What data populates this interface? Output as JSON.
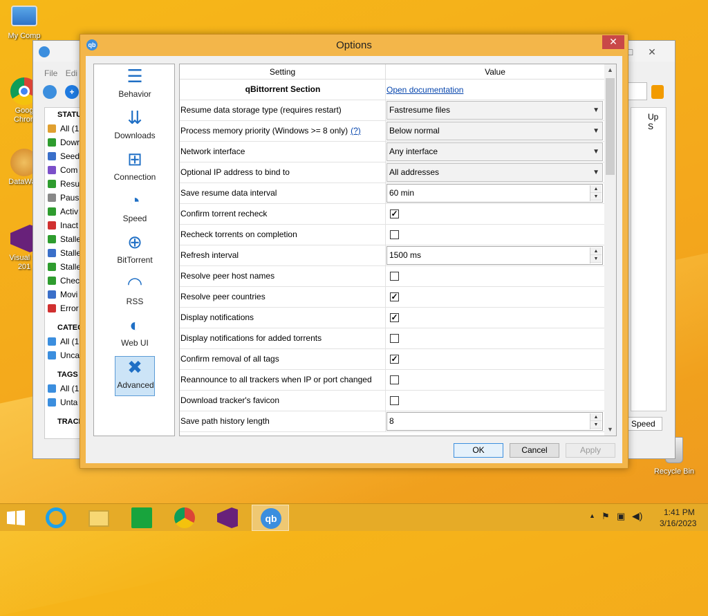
{
  "desktop": {
    "icons": [
      {
        "label": "My Comp",
        "icon": "computer-icon"
      },
      {
        "label": "Goog",
        "label2": "Chron",
        "icon": "chrome-icon"
      },
      {
        "label": "DataWag",
        "icon": "datawag-icon"
      },
      {
        "label": "Visual St",
        "label2": "201",
        "icon": "visual-studio-icon"
      },
      {
        "label": "Recycle Bin",
        "icon": "recycle-bin-icon"
      }
    ]
  },
  "main_window": {
    "menu": [
      "File",
      "Edi"
    ],
    "sidebar": {
      "status_header": "STATU",
      "status_items": [
        {
          "label": "All (1",
          "icon": "all-icon",
          "color": "#e0a030"
        },
        {
          "label": "Dowr",
          "icon": "download-icon",
          "color": "#2e9c2e"
        },
        {
          "label": "Seed",
          "icon": "seed-icon",
          "color": "#3a6fc9"
        },
        {
          "label": "Com",
          "icon": "check-icon",
          "color": "#7b4fc9"
        },
        {
          "label": "Resu",
          "icon": "play-icon",
          "color": "#2e9c2e"
        },
        {
          "label": "Paus",
          "icon": "pause-icon",
          "color": "#888888"
        },
        {
          "label": "Activ",
          "icon": "active-icon",
          "color": "#2e9c2e"
        },
        {
          "label": "Inact",
          "icon": "inactive-icon",
          "color": "#d03030"
        },
        {
          "label": "Stalle",
          "icon": "stalled-icon",
          "color": "#2e9c2e"
        },
        {
          "label": "Stalle",
          "icon": "stalled-up-icon",
          "color": "#3a6fc9"
        },
        {
          "label": "Stalle",
          "icon": "stalled-down-icon",
          "color": "#2e9c2e"
        },
        {
          "label": "Chec",
          "icon": "checking-icon",
          "color": "#2e9c2e"
        },
        {
          "label": "Movi",
          "icon": "moving-icon",
          "color": "#3a6fc9"
        },
        {
          "label": "Error",
          "icon": "error-icon",
          "color": "#d03030"
        }
      ],
      "categories_header": "CATEG",
      "categories_items": [
        {
          "label": "All (1",
          "icon": "list-icon"
        },
        {
          "label": "Unca",
          "icon": "list-icon"
        }
      ],
      "tags_header": "TAGS",
      "tags_items": [
        {
          "label": "All (1",
          "icon": "tag-icon"
        },
        {
          "label": "Unta",
          "icon": "tag-icon"
        }
      ],
      "trackers_header": "TRACK"
    },
    "col_header": "Up S",
    "speed_tab": "Speed"
  },
  "dialog": {
    "title": "Options",
    "nav": [
      {
        "label": "Behavior",
        "icon": "sliders-icon"
      },
      {
        "label": "Downloads",
        "icon": "downloads-icon"
      },
      {
        "label": "Connection",
        "icon": "network-icon"
      },
      {
        "label": "Speed",
        "icon": "speedometer-icon"
      },
      {
        "label": "BitTorrent",
        "icon": "globe-icon"
      },
      {
        "label": "RSS",
        "icon": "rss-icon"
      },
      {
        "label": "Web UI",
        "icon": "planet-icon"
      },
      {
        "label": "Advanced",
        "icon": "tools-icon",
        "selected": true
      }
    ],
    "table": {
      "col_setting": "Setting",
      "col_value": "Value",
      "section": "qBittorrent Section",
      "doc_link": "Open documentation",
      "rows": [
        {
          "label": "Resume data storage type (requires restart)",
          "type": "combo",
          "value": "Fastresume files"
        },
        {
          "label": "Process memory priority (Windows >= 8 only)",
          "help": "(?)",
          "type": "combo",
          "value": "Below normal"
        },
        {
          "label": "Network interface",
          "type": "combo",
          "value": "Any interface"
        },
        {
          "label": "Optional IP address to bind to",
          "type": "combo",
          "value": "All addresses"
        },
        {
          "label": "Save resume data interval",
          "type": "spin",
          "value": "60 min"
        },
        {
          "label": "Confirm torrent recheck",
          "type": "check",
          "value": "checked"
        },
        {
          "label": "Recheck torrents on completion",
          "type": "check",
          "value": "unchecked"
        },
        {
          "label": "Refresh interval",
          "type": "spin",
          "value": "1500 ms"
        },
        {
          "label": "Resolve peer host names",
          "type": "check",
          "value": "unchecked"
        },
        {
          "label": "Resolve peer countries",
          "type": "check",
          "value": "checked"
        },
        {
          "label": "Display notifications",
          "type": "check",
          "value": "checked"
        },
        {
          "label": "Display notifications for added torrents",
          "type": "check",
          "value": "unchecked"
        },
        {
          "label": "Confirm removal of all tags",
          "type": "check",
          "value": "checked"
        },
        {
          "label": "Reannounce to all trackers when IP or port changed",
          "type": "check",
          "value": "unchecked"
        },
        {
          "label": "Download tracker's favicon",
          "type": "check",
          "value": "unchecked"
        },
        {
          "label": "Save path history length",
          "type": "spin",
          "value": "8"
        }
      ]
    },
    "buttons": {
      "ok": "OK",
      "cancel": "Cancel",
      "apply": "Apply"
    }
  },
  "taskbar": {
    "apps": [
      "start-icon",
      "internet-explorer-icon",
      "file-explorer-icon",
      "store-icon",
      "chrome-icon",
      "visual-studio-icon",
      "qbittorrent-icon"
    ],
    "time": "1:41 PM",
    "date": "3/16/2023"
  },
  "colors": {
    "accent": "#f3b64a",
    "close": "#c94848",
    "link": "#0645ad",
    "qbit_blue": "#3b8ede"
  }
}
